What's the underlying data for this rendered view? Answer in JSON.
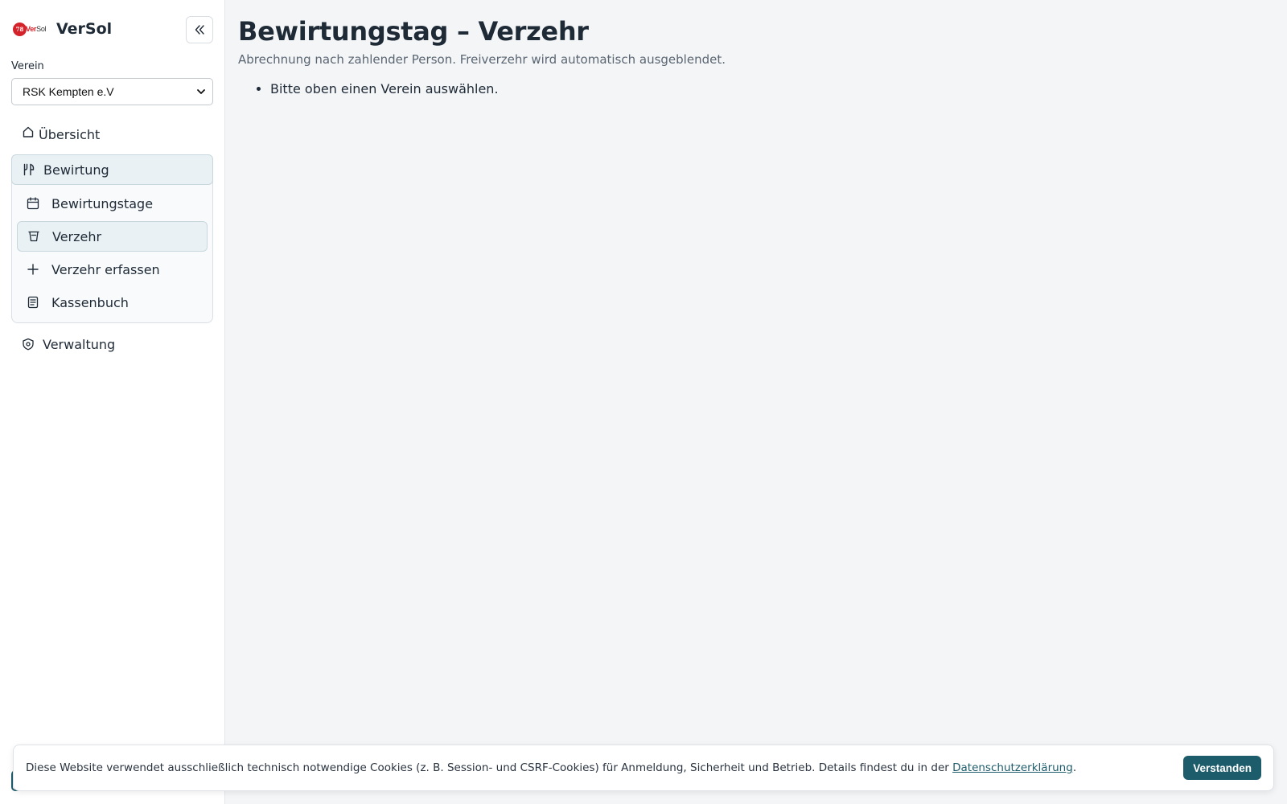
{
  "app": {
    "brand_name": "VerSol",
    "logo_text": "VerSol"
  },
  "sidebar": {
    "verein_label": "Verein",
    "verein_selected": "RSK Kempten e.V",
    "items": [
      {
        "label": "Übersicht",
        "icon": "home-icon"
      },
      {
        "label": "Bewirtung",
        "icon": "utensils-icon",
        "expanded": true,
        "children": [
          {
            "label": "Bewirtungstage",
            "icon": "calendar-icon"
          },
          {
            "label": "Verzehr",
            "icon": "cup-icon",
            "active": true
          },
          {
            "label": "Verzehr erfassen",
            "icon": "plus-icon"
          },
          {
            "label": "Kassenbuch",
            "icon": "receipt-icon"
          }
        ]
      },
      {
        "label": "Verwaltung",
        "icon": "shield-icon"
      }
    ]
  },
  "main": {
    "title": "Bewirtungstag – Verzehr",
    "subtitle": "Abrechnung nach zahlender Person. Freiverzehr wird automatisch ausgeblendet.",
    "notices": [
      "Bitte oben einen Verein auswählen."
    ]
  },
  "cookie_banner": {
    "text": "Diese Website verwendet ausschließlich technisch notwendige Cookies (z. B. Session- und CSRF-Cookies) für Anmeldung, Sicherheit und Betrieb. Details findest du in der",
    "link": "Datenschutzerklärung",
    "after_link": ".",
    "button": "Verstanden"
  },
  "colors": {
    "accent": "#1d5c6b",
    "brand_red": "#d4232b",
    "active_bg": "#e9f1f4"
  }
}
